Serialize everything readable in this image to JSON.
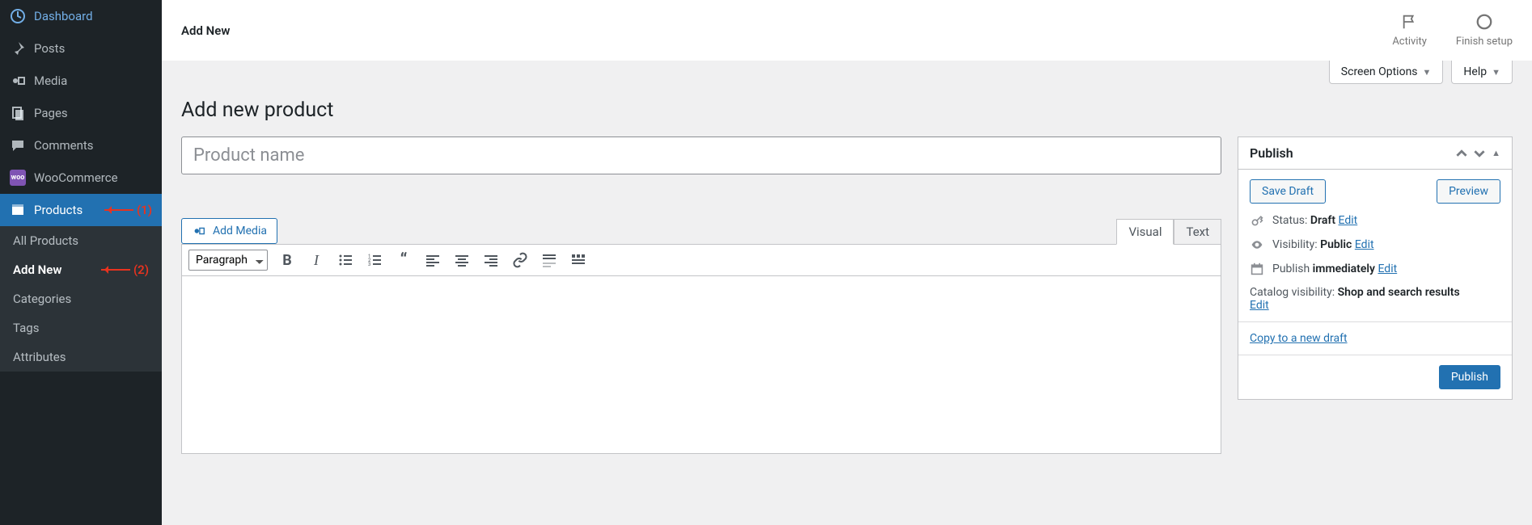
{
  "sidebar": {
    "items": [
      {
        "label": "Dashboard",
        "icon": "dashboard"
      },
      {
        "label": "Posts",
        "icon": "pin"
      },
      {
        "label": "Media",
        "icon": "media"
      },
      {
        "label": "Pages",
        "icon": "pages"
      },
      {
        "label": "Comments",
        "icon": "comments"
      },
      {
        "label": "WooCommerce",
        "icon": "woo"
      },
      {
        "label": "Products",
        "icon": "products",
        "active": true,
        "annotation": "(1)"
      }
    ],
    "sub": [
      {
        "label": "All Products"
      },
      {
        "label": "Add New",
        "active": true,
        "annotation": "(2)"
      },
      {
        "label": "Categories"
      },
      {
        "label": "Tags"
      },
      {
        "label": "Attributes"
      }
    ]
  },
  "topbar": {
    "title": "Add New",
    "activity": "Activity",
    "finish": "Finish setup"
  },
  "screen_options": "Screen Options",
  "help": "Help",
  "page_heading": "Add new product",
  "title_placeholder": "Product name",
  "add_media": "Add Media",
  "editor_tabs": {
    "visual": "Visual",
    "text": "Text"
  },
  "format_select": "Paragraph",
  "publish": {
    "box_title": "Publish",
    "save_draft": "Save Draft",
    "preview": "Preview",
    "status_label": "Status:",
    "status_value": "Draft",
    "edit": "Edit",
    "visibility_label": "Visibility:",
    "visibility_value": "Public",
    "publish_label": "Publish",
    "publish_value": "immediately",
    "catalog_label": "Catalog visibility:",
    "catalog_value": "Shop and search results",
    "copy_draft": "Copy to a new draft",
    "publish_btn": "Publish"
  }
}
